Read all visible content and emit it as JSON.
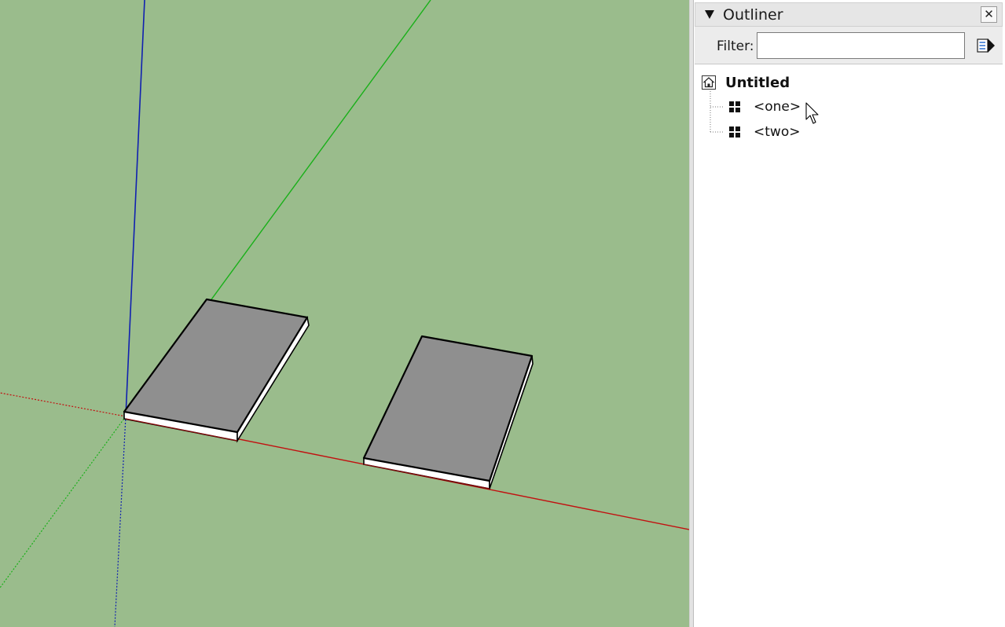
{
  "viewport": {
    "background_color": "#9abc8c",
    "axis_colors": {
      "red": "#c21010",
      "green": "#19b019",
      "blue": "#1020b0"
    },
    "component_colors": {
      "top_face": "#8f8f8f",
      "edge": "#000000",
      "side_face": "#ffffff"
    }
  },
  "outliner": {
    "title": "Outliner",
    "close_symbol": "✕",
    "filter_label": "Filter:",
    "filter_value": "",
    "filter_placeholder": "",
    "details_icon": "details-arrow-icon",
    "tree": {
      "root": {
        "label": "Untitled",
        "icon": "model-icon"
      },
      "items": [
        {
          "label": "<one>",
          "icon": "component-icon"
        },
        {
          "label": "<two>",
          "icon": "component-icon"
        }
      ]
    }
  }
}
